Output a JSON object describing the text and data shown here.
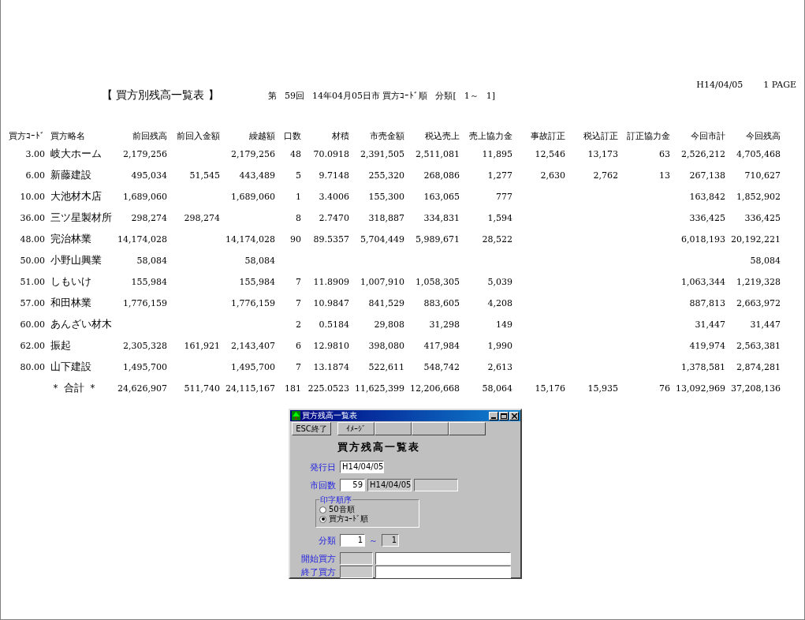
{
  "report": {
    "title": "【 買方別残高一覧表 】",
    "meta": [
      "第",
      "59回",
      "14年04月05日市 買方ｺｰﾄﾞ順",
      "分類[",
      "1～",
      "1]"
    ],
    "print_date": "H14/04/05",
    "page": "1 PAGE",
    "columns": [
      "買方ｺｰﾄﾞ",
      "買方略名",
      "前回残高",
      "前回入金額",
      "繰越額",
      "口数",
      "材積",
      "市売金額",
      "税込売上",
      "売上協力金",
      "事故訂正",
      "税込訂正",
      "訂正協力金",
      "今回市計",
      "今回残高"
    ],
    "rows": [
      {
        "cells": [
          "3.00",
          "岐大ホーム",
          "2,179,256",
          null,
          "2,179,256",
          "48",
          "70.0918",
          "2,391,505",
          "2,511,081",
          "11,895",
          "12,546",
          "13,173",
          "63",
          "2,526,212",
          "4,705,468"
        ]
      },
      {
        "cells": [
          "6.00",
          "新藤建設",
          "495,034",
          "51,545",
          "443,489",
          "5",
          "9.7148",
          "255,320",
          "268,086",
          "1,277",
          "2,630",
          "2,762",
          "13",
          "267,138",
          "710,627"
        ]
      },
      {
        "cells": [
          "10.00",
          "大池材木店",
          "1,689,060",
          null,
          "1,689,060",
          "1",
          "3.4006",
          "155,300",
          "163,065",
          "777",
          null,
          null,
          null,
          "163,842",
          "1,852,902"
        ]
      },
      {
        "cells": [
          "36.00",
          "三ツ星製材所",
          "298,274",
          "298,274",
          null,
          "8",
          "2.7470",
          "318,887",
          "334,831",
          "1,594",
          null,
          null,
          null,
          "336,425",
          "336,425"
        ]
      },
      {
        "cells": [
          "48.00",
          "完治林業",
          "14,174,028",
          null,
          "14,174,028",
          "90",
          "89.5357",
          "5,704,449",
          "5,989,671",
          "28,522",
          null,
          null,
          null,
          "6,018,193",
          "20,192,221"
        ]
      },
      {
        "cells": [
          "50.00",
          "小野山興業",
          "58,084",
          null,
          "58,084",
          null,
          null,
          null,
          null,
          null,
          null,
          null,
          null,
          null,
          "58,084"
        ]
      },
      {
        "cells": [
          "51.00",
          "しもいけ",
          "155,984",
          null,
          "155,984",
          "7",
          "11.8909",
          "1,007,910",
          "1,058,305",
          "5,039",
          null,
          null,
          null,
          "1,063,344",
          "1,219,328"
        ]
      },
      {
        "cells": [
          "57.00",
          "和田林業",
          "1,776,159",
          null,
          "1,776,159",
          "7",
          "10.9847",
          "841,529",
          "883,605",
          "4,208",
          null,
          null,
          null,
          "887,813",
          "2,663,972"
        ]
      },
      {
        "cells": [
          "60.00",
          "あんざい材木",
          null,
          null,
          null,
          "2",
          "0.5184",
          "29,808",
          "31,298",
          "149",
          null,
          null,
          null,
          "31,447",
          "31,447"
        ]
      },
      {
        "cells": [
          "62.00",
          "振起",
          "2,305,328",
          "161,921",
          "2,143,407",
          "6",
          "12.9810",
          "398,080",
          "417,984",
          "1,990",
          null,
          null,
          null,
          "419,974",
          "2,563,381"
        ]
      },
      {
        "cells": [
          "80.00",
          "山下建設",
          "1,495,700",
          null,
          "1,495,700",
          "7",
          "13.1874",
          "522,611",
          "548,742",
          "2,613",
          null,
          null,
          null,
          "1,378,581",
          "2,874,281"
        ]
      },
      {
        "cells": [
          null,
          "＊ 合計 ＊",
          "24,626,907",
          "511,740",
          "24,115,167",
          "181",
          "225.0523",
          "11,625,399",
          "12,206,668",
          "58,064",
          "15,176",
          "15,935",
          "76",
          "13,092,969",
          "37,208,136"
        ]
      }
    ]
  },
  "dialog": {
    "title": "買方残高一覧表",
    "toolbar": [
      {
        "label": "ESC終了",
        "kind": "exit"
      },
      {
        "label": "ｲﾒｰｼﾞ",
        "kind": "tab"
      }
    ],
    "heading": "買方残高一覧表",
    "issue_date": {
      "label": "発行日",
      "value": "H14/04/05"
    },
    "market_count": {
      "label": "市回数",
      "value": "59",
      "date": "H14/04/05"
    },
    "print_order": {
      "legend": "印字順序",
      "options": [
        {
          "label": "50音順",
          "selected": false
        },
        {
          "label": "買方ｺｰﾄﾞ順",
          "selected": true
        }
      ]
    },
    "category": {
      "label": "分類",
      "from": "1",
      "separator": "～",
      "to": "1"
    },
    "buyers": [
      {
        "label": "開始買方"
      },
      {
        "label": "終了買方"
      }
    ]
  }
}
